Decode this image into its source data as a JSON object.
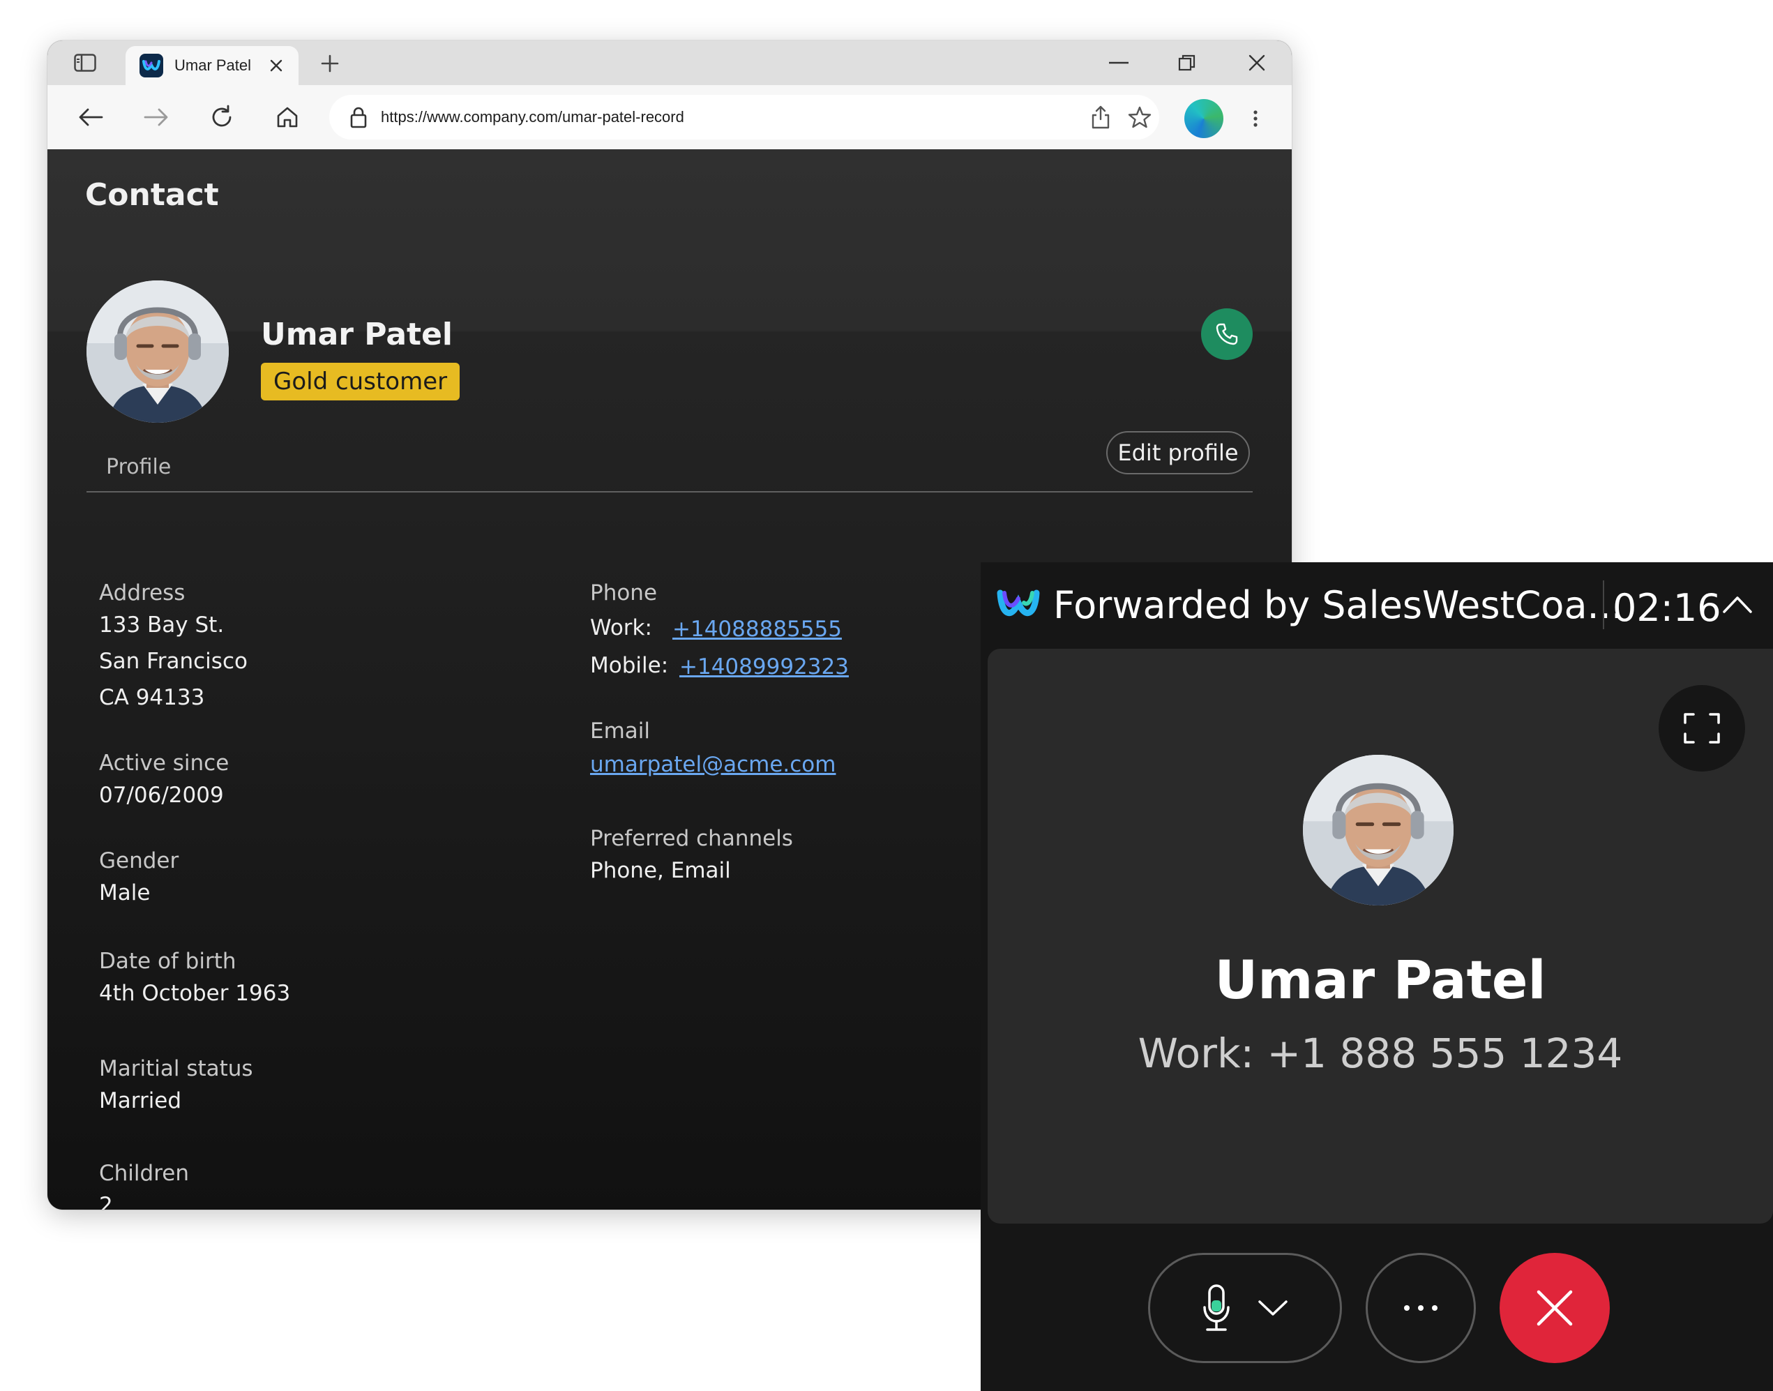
{
  "browser": {
    "tab_title": "Umar Patel",
    "url": "https://www.company.com/umar-patel-record"
  },
  "contact": {
    "page_title": "Contact",
    "name": "Umar Patel",
    "badge": "Gold customer",
    "edit_profile": "Edit profile",
    "tab_profile": "Profile",
    "fields": {
      "address_label": "Address",
      "address_line1": "133 Bay St.",
      "address_line2": "San Francisco",
      "address_line3": "CA 94133",
      "active_since_label": "Active since",
      "active_since": "07/06/2009",
      "gender_label": "Gender",
      "gender": "Male",
      "dob_label": "Date of birth",
      "dob": "4th October 1963",
      "marital_label": "Maritial status",
      "marital": "Married",
      "children_label": "Children",
      "children": "2",
      "phone_label": "Phone",
      "work_label": "Work:",
      "work_phone": "+14088885555",
      "mobile_label": "Mobile:",
      "mobile_phone": "+14089992323",
      "email_label": "Email",
      "email": "umarpatel@acme.com",
      "channels_label": "Preferred channels",
      "channels": "Phone, Email"
    }
  },
  "call": {
    "forwarded": "Forwarded by SalesWestCoa...",
    "timer": "02:16",
    "caller_name": "Umar Patel",
    "caller_number": "Work: +1 888 555 1234"
  },
  "colors": {
    "badge": "#e7bb22",
    "call_green": "#1e8c5f",
    "end_red": "#e0253a",
    "link": "#6aa7f0"
  }
}
